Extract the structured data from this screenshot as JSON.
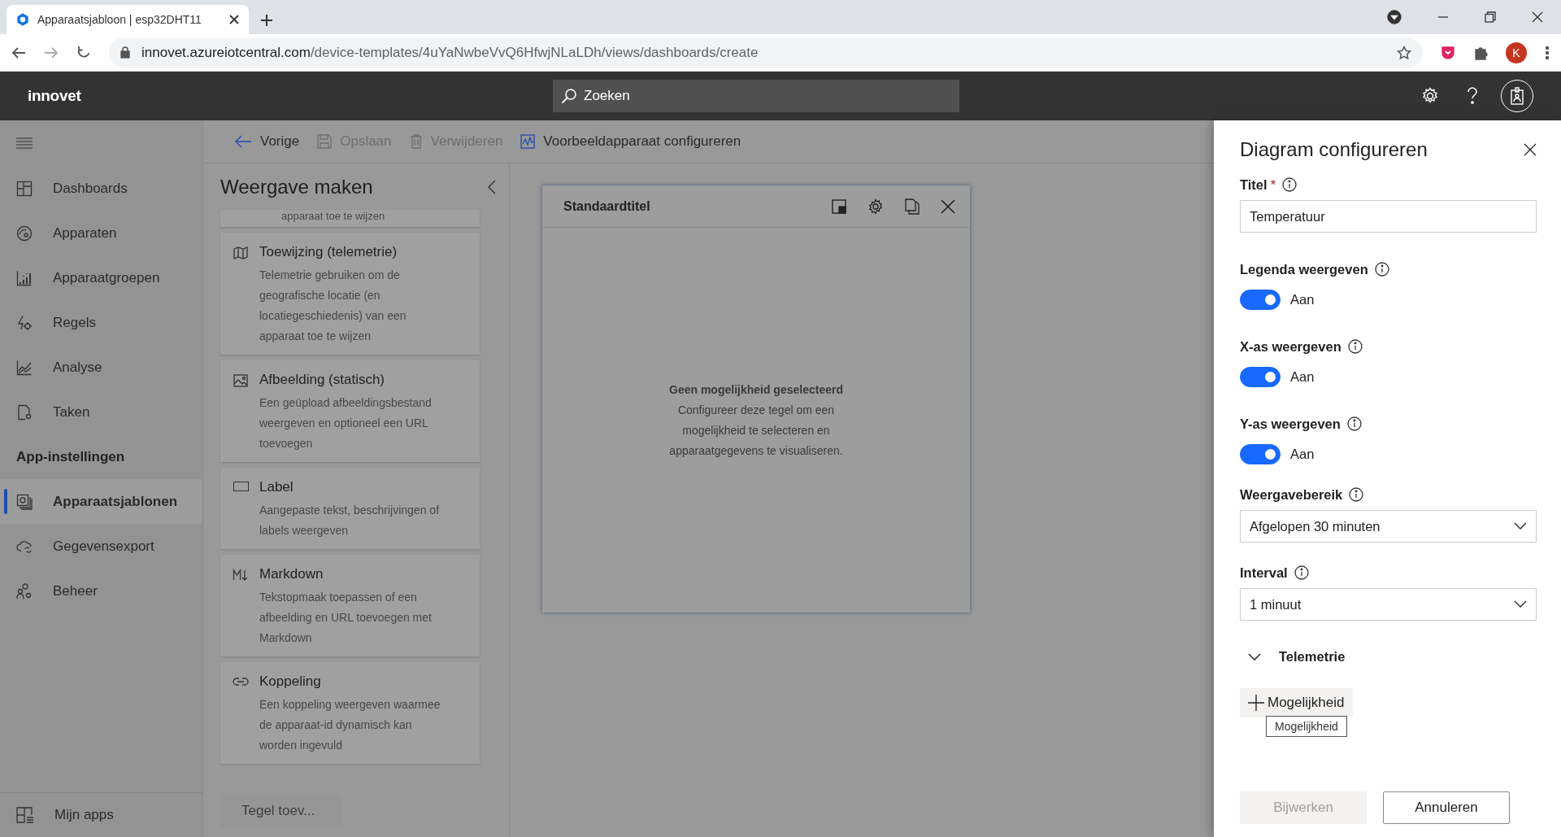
{
  "browser": {
    "tab_title": "Apparaatsjabloon | esp32DHT11",
    "url_host": "innovet.azureiotcentral.com",
    "url_path": "/device-templates/4uYaNwbeVvQ6HfwjNLaLDh/views/dashboards/create",
    "profile_initial": "K"
  },
  "app_header": {
    "app_name": "innovet",
    "search": {
      "placeholder": "Zoeken"
    }
  },
  "sidebar": {
    "items": [
      {
        "label": "Dashboards",
        "selected": false
      },
      {
        "label": "Apparaten",
        "selected": false
      },
      {
        "label": "Apparaatgroepen",
        "selected": false
      },
      {
        "label": "Regels",
        "selected": false
      },
      {
        "label": "Analyse",
        "selected": false
      },
      {
        "label": "Taken",
        "selected": false
      }
    ],
    "section_title": "App-instellingen",
    "settings_items": [
      {
        "label": "Apparaatsjablonen",
        "selected": true
      },
      {
        "label": "Gegevensexport",
        "selected": false
      },
      {
        "label": "Beheer",
        "selected": false
      }
    ],
    "footer_item": {
      "label": "Mijn apps"
    }
  },
  "toolbar": [
    {
      "label": "Vorige",
      "disabled": false
    },
    {
      "label": "Opslaan",
      "disabled": true
    },
    {
      "label": "Verwijderen",
      "disabled": true
    },
    {
      "label": "Voorbeeldapparaat configureren",
      "disabled": false
    }
  ],
  "library": {
    "title": "Weergave maken",
    "partial_card_text": "apparaat toe te wijzen",
    "cards": [
      {
        "title": "Toewijzing (telemetrie)",
        "description": "Telemetrie gebruiken om de geografische locatie (en locatiegeschiedenis) van een apparaat toe te wijzen"
      },
      {
        "title": "Afbeelding (statisch)",
        "description": "Een geüpload afbeeldingsbestand weergeven en optioneel een URL toevoegen"
      },
      {
        "title": "Label",
        "description": "Aangepaste tekst, beschrijvingen of labels weergeven"
      },
      {
        "title": "Markdown",
        "description": "Tekstopmaak toepassen of een afbeelding en URL toevoegen met Markdown"
      },
      {
        "title": "Koppeling",
        "description": "Een koppeling weergeven waarmee de apparaat-id dynamisch kan worden ingevuld"
      }
    ],
    "add_button": {
      "label": "Tegel toev...",
      "disabled": true
    }
  },
  "tile": {
    "title": "Standaardtitel",
    "empty_title": "Geen mogelijkheid geselecteerd",
    "empty_text": "Configureer deze tegel om een mogelijkheid te selecteren en apparaatgegevens te visualiseren."
  },
  "config_panel": {
    "title": "Diagram configureren",
    "title_field": {
      "label": "Titel",
      "required_mark": "*",
      "value": "Temperatuur"
    },
    "toggles": [
      {
        "label": "Legenda weergeven",
        "on": true,
        "state_text": "Aan"
      },
      {
        "label": "X-as weergeven",
        "on": true,
        "state_text": "Aan"
      },
      {
        "label": "Y-as weergeven",
        "on": true,
        "state_text": "Aan"
      }
    ],
    "dropdowns": [
      {
        "label": "Weergavebereik",
        "value": "Afgelopen 30 minuten"
      },
      {
        "label": "Interval",
        "value": "1 minuut"
      }
    ],
    "section": {
      "label": "Telemetrie",
      "expanded": true
    },
    "add_button": {
      "label": "Mogelijkheid"
    },
    "tooltip": "Mogelijkheid",
    "buttons": [
      {
        "label": "Bijwerken",
        "disabled": true
      },
      {
        "label": "Annuleren",
        "disabled": false
      }
    ]
  }
}
